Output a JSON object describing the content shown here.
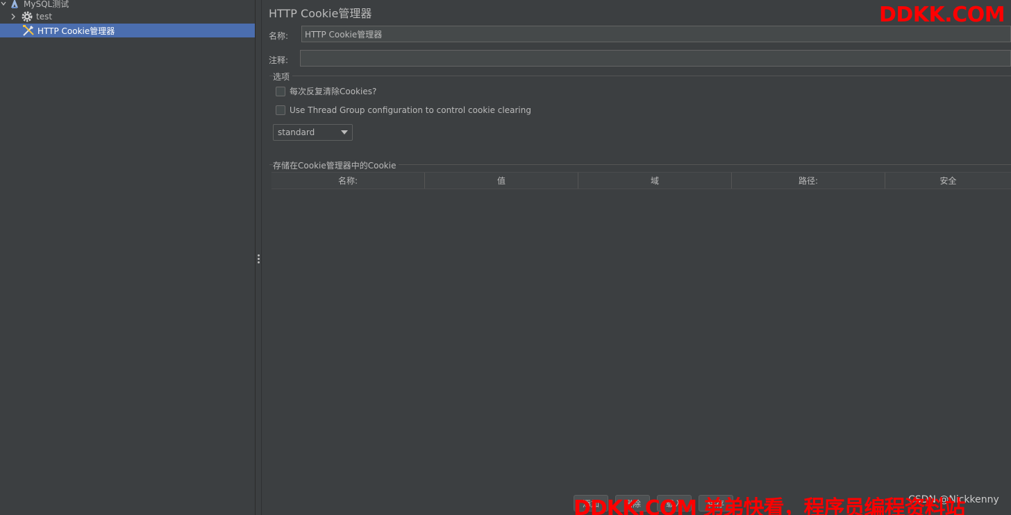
{
  "tree": {
    "items": [
      {
        "label": "MySQL测试",
        "icon": "testplan-icon"
      },
      {
        "label": "test",
        "icon": "gear-icon"
      },
      {
        "label": "HTTP Cookie管理器",
        "icon": "tools-icon",
        "selected": true
      }
    ]
  },
  "editor": {
    "title": "HTTP Cookie管理器",
    "name_label": "名称:",
    "name_value": "HTTP Cookie管理器",
    "comment_label": "注释:",
    "comment_value": "",
    "options_group": {
      "title": "选项",
      "clear_each_iteration": {
        "label": "每次反复清除Cookies?",
        "checked": false
      },
      "use_thread_group": {
        "label": "Use Thread Group configuration to control cookie clearing",
        "checked": false
      },
      "policy_select": {
        "value": "standard"
      }
    },
    "cookies_group": {
      "title": "存储在Cookie管理器中的Cookie",
      "columns": [
        "名称:",
        "值",
        "域",
        "路径:",
        "安全"
      ]
    },
    "buttons": [
      {
        "label": "添加"
      },
      {
        "label": "删除"
      },
      {
        "label": "载入"
      },
      {
        "label": "保存"
      }
    ]
  },
  "watermarks": {
    "top": "DDKK.COM",
    "bottom": "DDKK.COM 弟弟快看，程序员编程资料站",
    "credit": "CSDN @Nickkenny"
  },
  "colors": {
    "selection": "#4b6eaf",
    "background": "#3c3f41",
    "watermark": "#ff0000"
  }
}
